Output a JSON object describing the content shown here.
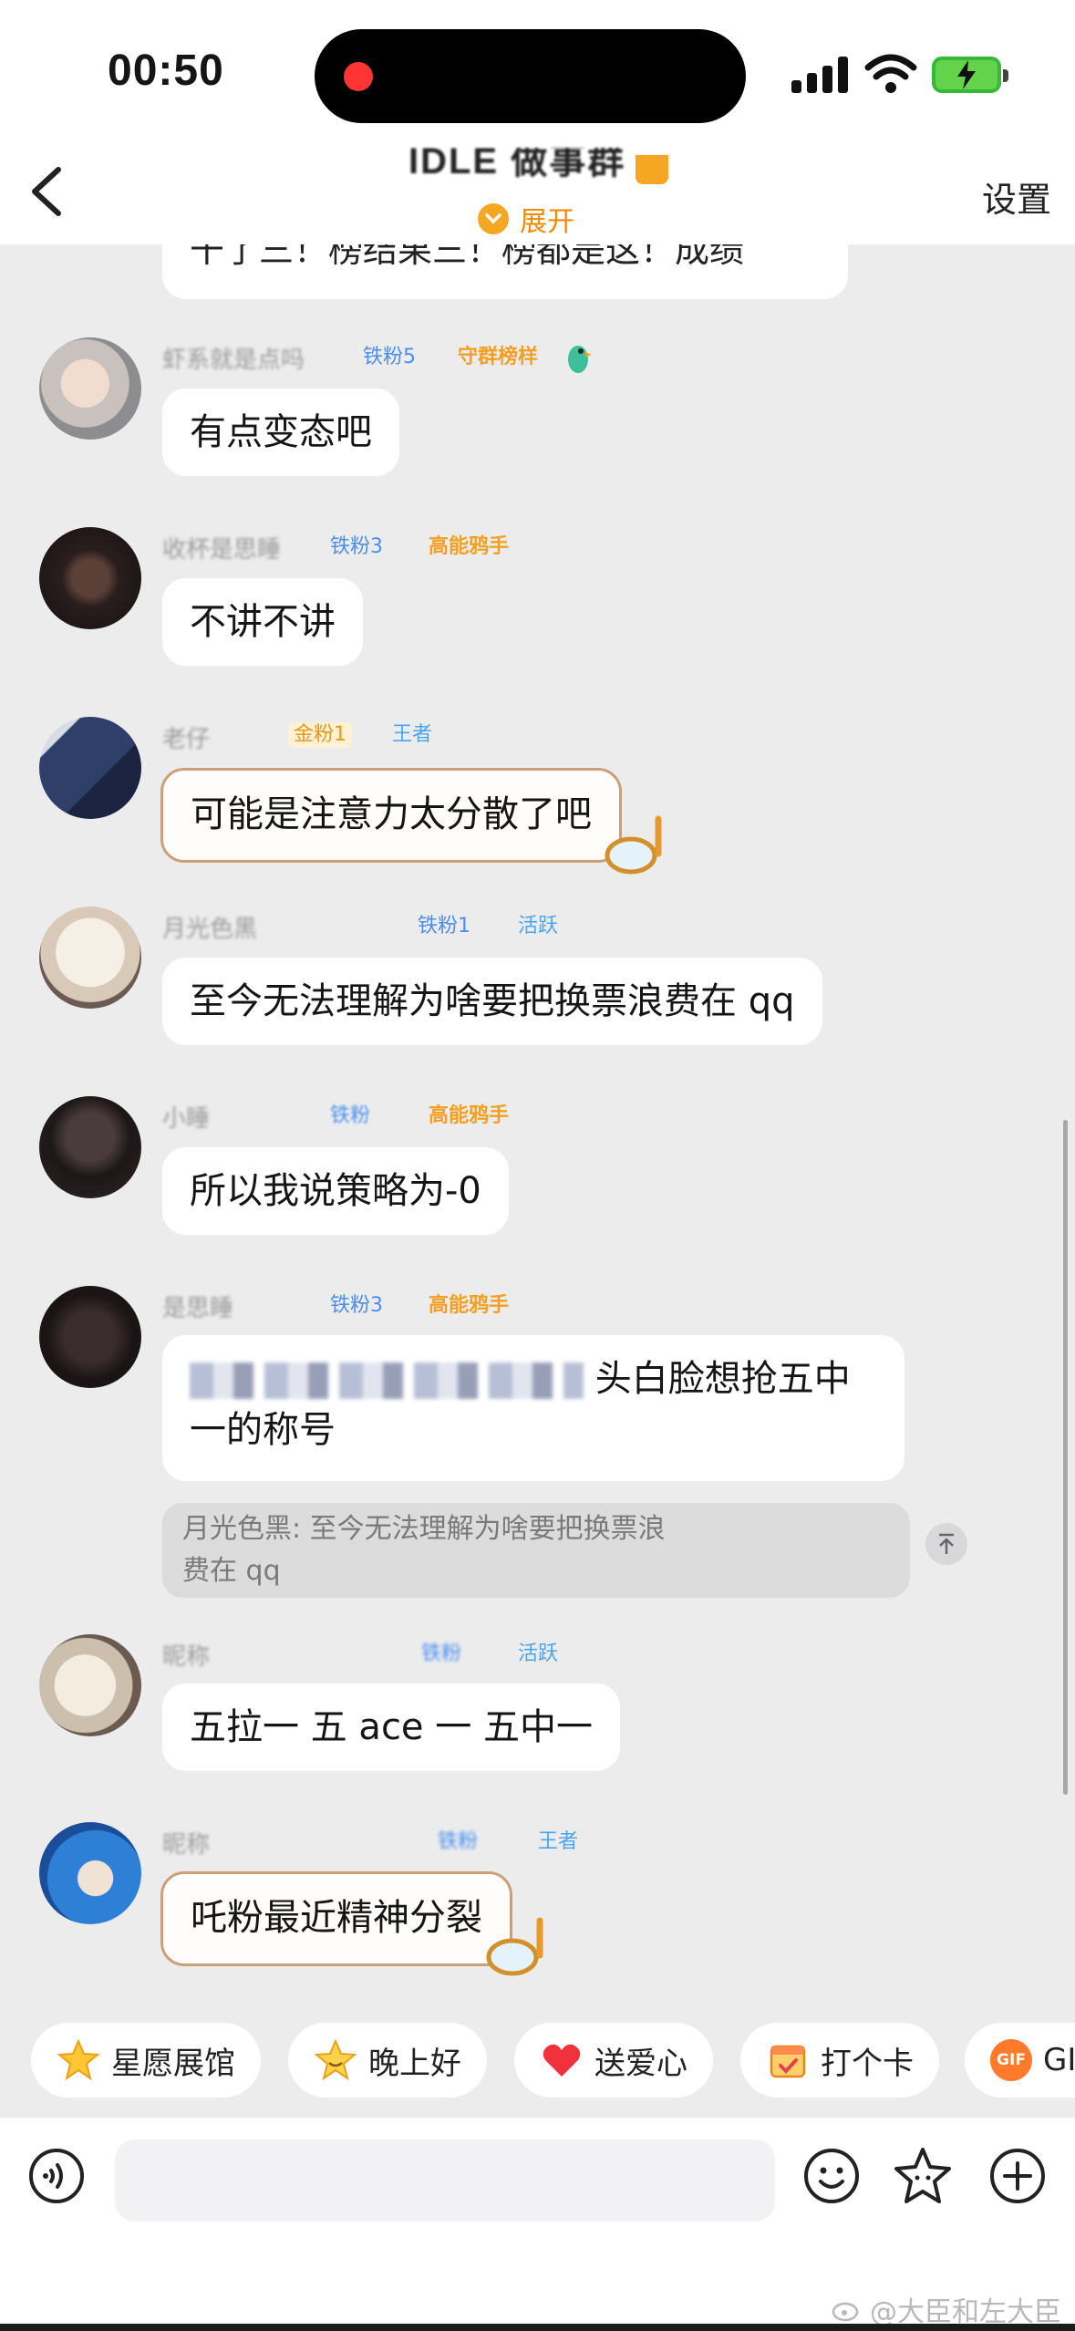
{
  "status_bar": {
    "time": "00:50",
    "battery_color": "#62d34b",
    "recording_dot_color": "#ff3434"
  },
  "header": {
    "back_icon": "chevron-left-icon",
    "group_title": "IDLE 做事群",
    "expand_label": "展开",
    "settings_label": "设置",
    "accent_color": "#f5a623"
  },
  "chat": {
    "cut_message_tail": "干了三！榜结果三！榜都是这！成绩",
    "messages": [
      {
        "nickname": "虾系就是点吗",
        "badges": [
          "铁粉5",
          "守群榜样"
        ],
        "text": "有点变态吧"
      },
      {
        "nickname": "收杯是思睡",
        "badges": [
          "铁粉3",
          "高能鸦手"
        ],
        "text": "不讲不讲"
      },
      {
        "nickname": "老仔",
        "badges": [
          "金粉1",
          "王者"
        ],
        "text": "可能是注意力太分散了吧"
      },
      {
        "nickname": "月光色黑",
        "badges": [
          "铁粉1",
          "活跃"
        ],
        "text": "至今无法理解为啥要把换票浪费在 qq"
      },
      {
        "nickname": "小睡",
        "badges": [
          "铁粉",
          "高能鸦手"
        ],
        "text": "所以我说策略为-0"
      },
      {
        "nickname": "是思睡",
        "badges": [
          "铁粉3",
          "高能鸦手"
        ],
        "text_line1": "头白脸想抢五中",
        "text_line2": "一的称号",
        "quote_line1": "月光色黑: 至今无法理解为啥要把换票浪",
        "quote_line2": "费在 qq"
      },
      {
        "nickname": "昵称",
        "badges": [
          "铁粉",
          "活跃"
        ],
        "text": "五拉一 五 ace 一 五中一"
      },
      {
        "nickname": "昵称",
        "badges": [
          "铁粉",
          "王者"
        ],
        "text": "吒粉最近精神分裂"
      }
    ]
  },
  "quick_replies": [
    {
      "label": "星愿展馆",
      "icon": "star-face-icon"
    },
    {
      "label": "晚上好",
      "icon": "star-smile-icon"
    },
    {
      "label": "送爱心",
      "icon": "heart-icon"
    },
    {
      "label": "打个卡",
      "icon": "calendar-check-icon"
    },
    {
      "label": "GIF",
      "icon": "gif-icon"
    }
  ],
  "input_bar": {
    "placeholder": "",
    "icons": [
      "voice-icon",
      "emoji-icon",
      "star-icon",
      "plus-icon"
    ]
  },
  "watermark": "@大臣和左大臣"
}
